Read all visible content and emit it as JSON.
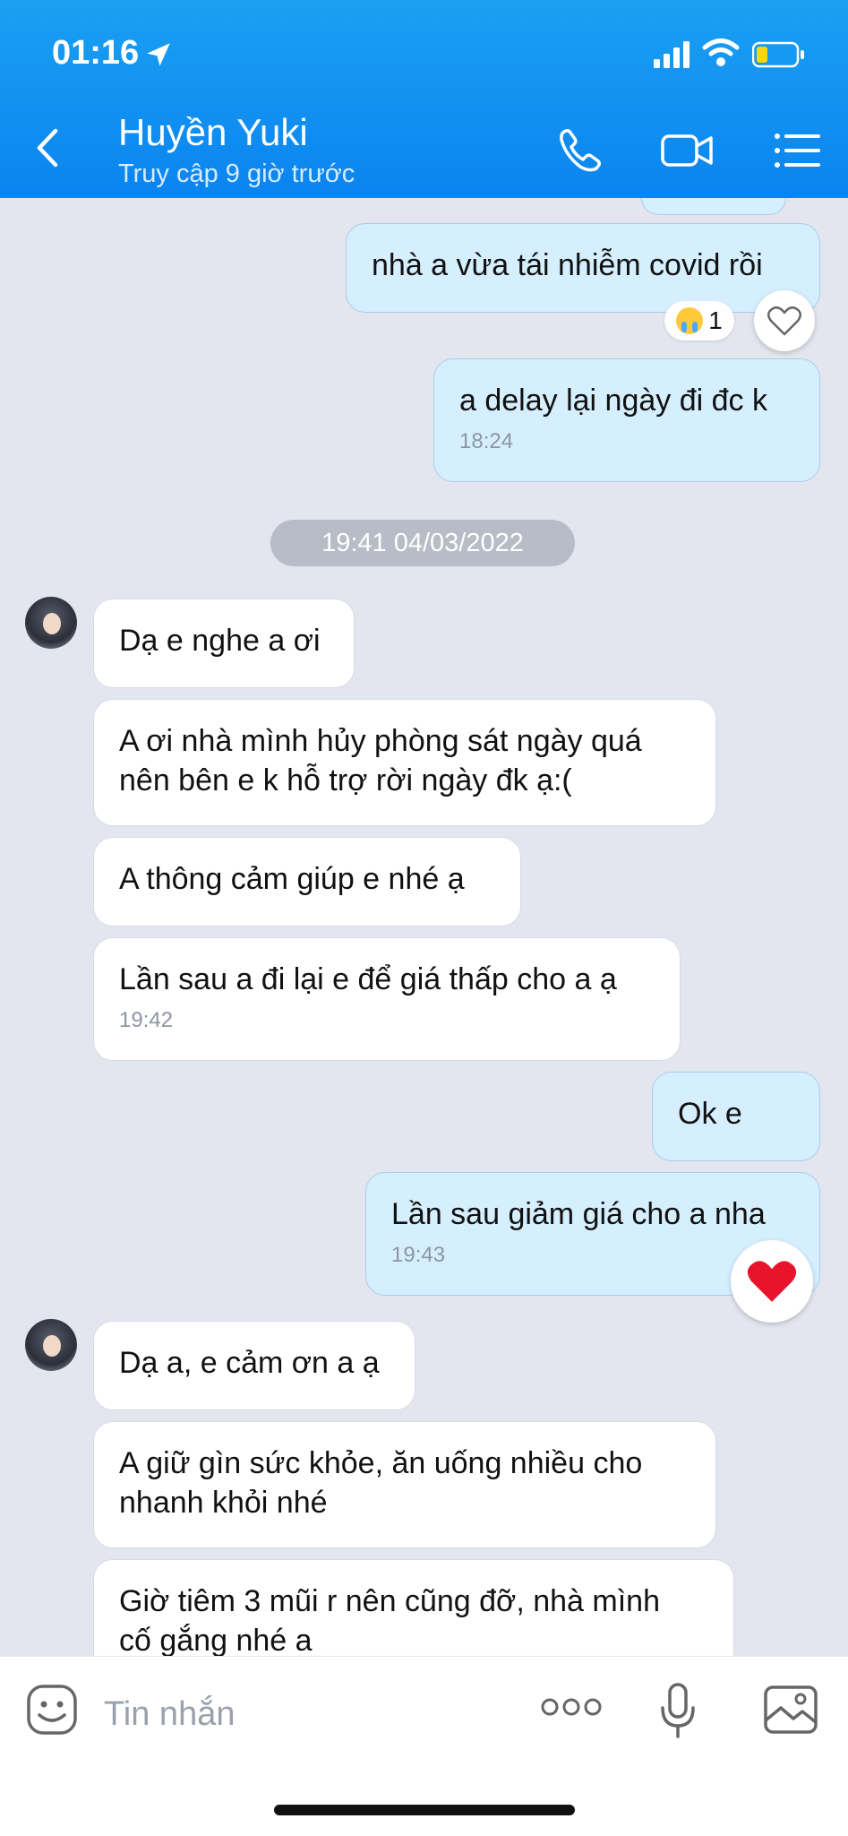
{
  "status_bar": {
    "time": "01:16"
  },
  "header": {
    "contact_name": "Huyền Yuki",
    "contact_status": "Truy cập 9 giờ trước"
  },
  "messages": [
    {
      "dir": "out",
      "text": "nhà a vừa tái nhiễm covid rồi",
      "time": "",
      "reaction": "cry",
      "reaction_count": "1"
    },
    {
      "dir": "out",
      "text": "a delay lại ngày đi đc k",
      "time": "18:24"
    },
    {
      "dir": "in",
      "text": "Dạ e nghe a ơi",
      "time": ""
    },
    {
      "dir": "in",
      "text": "A ơi nhà mình hủy phòng sát ngày quá\nnên bên e k hỗ trợ rời ngày đk ạ:(",
      "time": ""
    },
    {
      "dir": "in",
      "text": "A thông cảm giúp e nhé ạ",
      "time": ""
    },
    {
      "dir": "in",
      "text": "Lần sau a đi lại e để giá thấp cho a ạ",
      "time": "19:42"
    },
    {
      "dir": "out",
      "text": "Ok e",
      "time": ""
    },
    {
      "dir": "out",
      "text": "Lần sau giảm giá cho a nha",
      "time": "19:43",
      "reaction": "heart"
    },
    {
      "dir": "in",
      "text": "Dạ a, e cảm ơn a ạ",
      "time": ""
    },
    {
      "dir": "in",
      "text": "A giữ gìn sức khỏe, ăn uống nhiều cho\nnhanh khỏi nhé",
      "time": ""
    },
    {
      "dir": "in",
      "text": "Giờ tiêm 3 mũi r nên cũng đỡ, nhà mình\ncố gắng nhé a",
      "time": ""
    }
  ],
  "date_separator": "19:41 04/03/2022",
  "input": {
    "placeholder": "Tin nhắn"
  },
  "colors": {
    "header": "#0a84f0",
    "outgoing_bubble": "#d5efff",
    "incoming_bubble": "#ffffff",
    "background": "#e3e6ef",
    "heart": "#e8142b"
  },
  "icons": [
    "back-icon",
    "phone-icon",
    "video-icon",
    "menu-icon",
    "sticker-icon",
    "more-icon",
    "mic-icon",
    "image-icon",
    "heart-icon",
    "location-arrow-icon"
  ]
}
